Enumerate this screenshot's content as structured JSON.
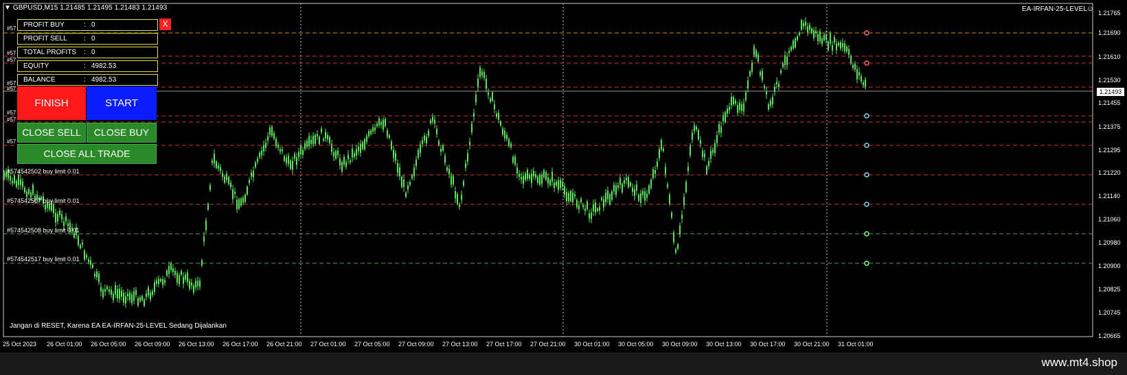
{
  "header": {
    "symbol": "GBPUSD,M15",
    "quotes": "1.21485 1.21495 1.21483 1.21493"
  },
  "ea": {
    "name": "EA-IRFAN-25-LEVEL",
    "smiley": "☺"
  },
  "panel": {
    "rows": [
      {
        "label": "PROFIT BUY",
        "value": "0"
      },
      {
        "label": "PROFIT SELL",
        "value": "0"
      },
      {
        "label": "TOTAL PROFITS",
        "value": "0"
      },
      {
        "label": "EQUITY",
        "value": "4982.53"
      },
      {
        "label": "BALANCE",
        "value": "4982.53"
      }
    ],
    "colon": ":",
    "close_label": "X"
  },
  "buttons": {
    "finish": "FINISH",
    "start": "START",
    "close_sell": "CLOSE SELL",
    "close_buy": "CLOSE BUY",
    "close_all": "CLOSE ALL TRADE"
  },
  "orders": [
    {
      "text": "#574542502 buy limit 0.01"
    },
    {
      "text": "#574542507 buy limit 0.01"
    },
    {
      "text": "#574542508 buy limit 0.01"
    },
    {
      "text": "#574542517 buy limit 0.01"
    }
  ],
  "stub_label": "#57",
  "footer_note": "Jangan di RESET, Karena EA EA-IRFAN-25-LEVEL Sedang Dijalankan",
  "price_axis": [
    "1.21765",
    "1.21690",
    "1.21610",
    "1.21530",
    "1.21455",
    "1.21375",
    "1.21295",
    "1.21220",
    "1.21140",
    "1.21060",
    "1.20980",
    "1.20900",
    "1.20825",
    "1.20745",
    "1.20665"
  ],
  "bid_price": "1.21493",
  "time_axis": [
    "25 Oct 2023",
    "26 Oct 01:00",
    "26 Oct 05:00",
    "26 Oct 09:00",
    "26 Oct 13:00",
    "26 Oct 17:00",
    "26 Oct 21:00",
    "27 Oct 01:00",
    "27 Oct 05:00",
    "27 Oct 09:00",
    "27 Oct 13:00",
    "27 Oct 17:00",
    "27 Oct 21:00",
    "30 Oct 01:00",
    "30 Oct 05:00",
    "30 Oct 09:00",
    "30 Oct 13:00",
    "30 Oct 17:00",
    "30 Oct 21:00",
    "31 Oct 01:00"
  ],
  "watermark": "www.mt4.shop",
  "colors": {
    "background": "#000000",
    "candle": "#5fe35f",
    "grid": "#c8c8c8",
    "sell_level": "#d23232",
    "buy_level": "#5a9a5a",
    "tp_level": "#e08a1a",
    "panel_border": "#e6d93b",
    "finish_bg": "#ff1a1a",
    "start_bg": "#0b1dff",
    "green_button": "#2a8a2a"
  }
}
